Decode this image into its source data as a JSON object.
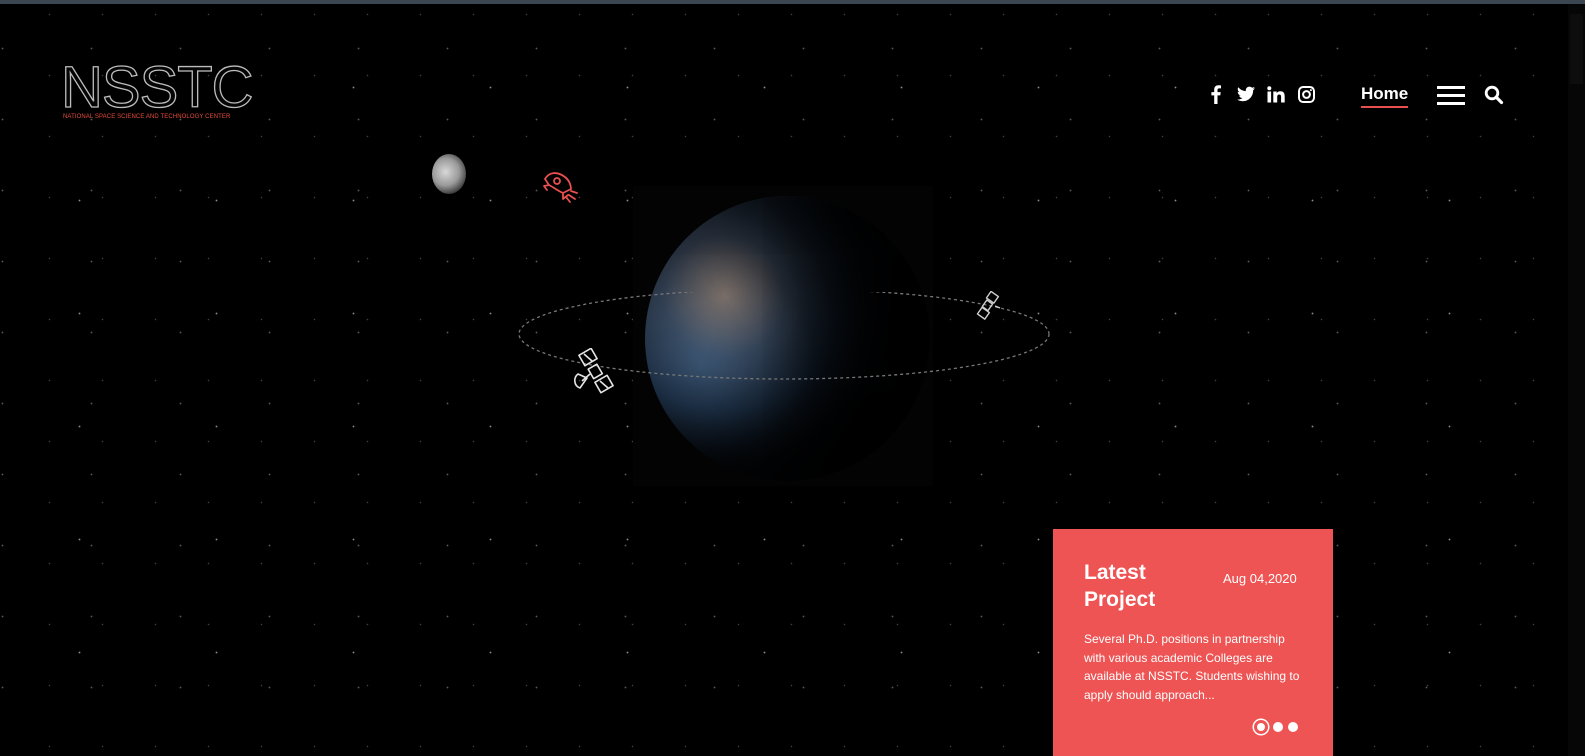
{
  "logo": {
    "word": "NSSTC",
    "subtitle": "NATIONAL SPACE SCIENCE AND TECHNOLOGY CENTER"
  },
  "header": {
    "social": [
      {
        "icon": "facebook-icon",
        "glyph": "f"
      },
      {
        "icon": "twitter-icon",
        "glyph": ""
      },
      {
        "icon": "linkedin-icon",
        "glyph": "in"
      },
      {
        "icon": "instagram-icon",
        "glyph": ""
      }
    ],
    "nav_active": "Home",
    "menu_icon": "hamburger-menu-icon",
    "search_icon": "search-icon"
  },
  "scene": {
    "elements": [
      "moon",
      "rocket-icon",
      "earth",
      "orbit-path",
      "satellite-icon",
      "satellite-icon"
    ]
  },
  "latest_project": {
    "title": "Latest Project",
    "date": "Aug 04,2020",
    "text": "Several Ph.D. positions in partnership with various academic Colleges are available at NSSTC. Students wishing to apply should approach...",
    "slides": 3,
    "active_slide": 1
  },
  "colors": {
    "accent": "#ef5454",
    "background": "#000000",
    "text": "#ffffff"
  }
}
